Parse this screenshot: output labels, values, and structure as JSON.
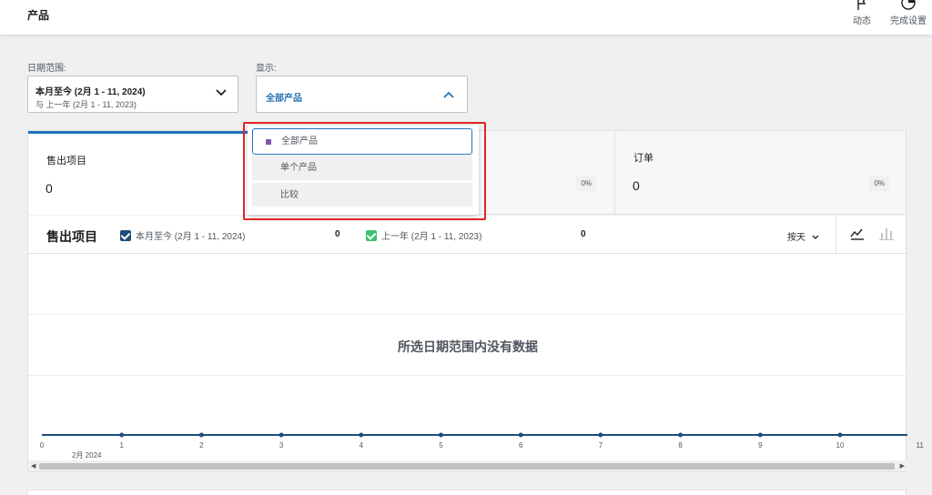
{
  "header": {
    "title": "产品",
    "activity_label": "动态",
    "finish_setup_label": "完成设置"
  },
  "filters": {
    "date_label": "日期范围:",
    "date_value": "本月至今 (2月 1 - 11, 2024)",
    "date_compare": "与 上一年 (2月 1 - 11, 2023)",
    "show_label": "显示:",
    "show_value": "全部产品",
    "show_options": [
      "全部产品",
      "单个产品",
      "比较"
    ]
  },
  "summary": [
    {
      "label": "售出项目",
      "value": "0",
      "change": ""
    },
    {
      "label": "",
      "value": "",
      "change": "0%"
    },
    {
      "label": "订单",
      "value": "0",
      "change": "0%"
    }
  ],
  "chart": {
    "title": "售出项目",
    "legend_current": "本月至今 (2月 1 - 11, 2024)",
    "legend_current_value": "0",
    "legend_previous": "上一年 (2月 1 - 11, 2023)",
    "legend_previous_value": "0",
    "interval": "按天",
    "no_data": "所选日期范围内没有数据",
    "x_sub_label": "2月 2024"
  },
  "colors": {
    "accent": "#1e73be",
    "current_series": "#1e4d78",
    "previous_series": "#3ec16d",
    "highlight": "#e02424"
  },
  "chart_data": {
    "type": "line",
    "x": [
      1,
      2,
      3,
      4,
      5,
      6,
      7,
      8,
      9,
      10,
      11
    ],
    "x_ticks": [
      "0",
      "1",
      "2",
      "3",
      "4",
      "5",
      "6",
      "7",
      "8",
      "9",
      "10",
      "11"
    ],
    "series": [
      {
        "name": "本月至今 (2月 1 - 11, 2024)",
        "values": [
          0,
          0,
          0,
          0,
          0,
          0,
          0,
          0,
          0,
          0,
          0
        ]
      },
      {
        "name": "上一年 (2月 1 - 11, 2023)",
        "values": [
          0,
          0,
          0,
          0,
          0,
          0,
          0,
          0,
          0,
          0,
          0
        ]
      }
    ],
    "ylim": [
      0,
      0
    ]
  }
}
